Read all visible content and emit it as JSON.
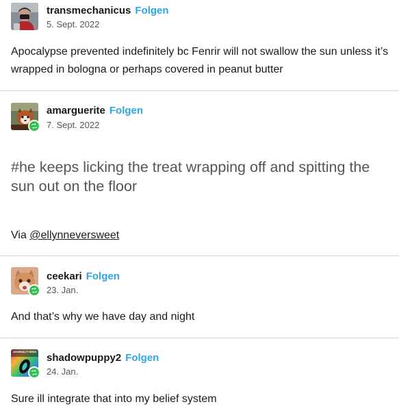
{
  "posts": [
    {
      "username": "transmechanicus",
      "follow_label": "Folgen",
      "date": "5. Sept. 2022",
      "text": "Apocalypse prevented indefinitely bc Fenrir will not swallow the sun unless it’s wrapped in bologna or perhaps covered in peanut butter",
      "avatar_icon": "user-avatar-icon",
      "reblogged": false
    },
    {
      "username": "amarguerite",
      "follow_label": "Folgen",
      "date": "7. Sept. 2022",
      "tag_text": "#he keeps licking the treat wrapping off and spitting the sun out on the floor",
      "via_prefix": "Via ",
      "via_mention": "@ellynneversweet",
      "avatar_icon": "red-panda-avatar-icon",
      "reblogged": true
    },
    {
      "username": "ceekari",
      "follow_label": "Folgen",
      "date": "23. Jan.",
      "text": "And that’s why we have day and night",
      "avatar_icon": "cat-avatar-icon",
      "reblogged": true
    },
    {
      "username": "shadowpuppy2",
      "follow_label": "Folgen",
      "date": "24. Jan.",
      "text": "Sure ill integrate that into my belief system",
      "avatar_icon": "rainbow-avatar-icon",
      "avatar_caption": "ASNORMALITY BEING",
      "reblogged": true
    }
  ],
  "colors": {
    "follow": "#2ea5e6",
    "reblog_badge": "#2fbf52",
    "divider": "#d9d9d9",
    "tag_text": "#555555"
  }
}
